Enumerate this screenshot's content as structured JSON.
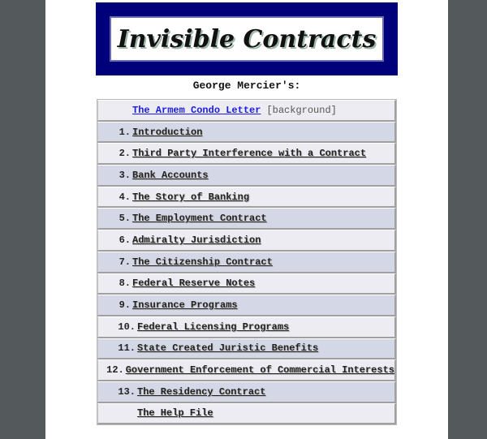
{
  "banner": {
    "title": "Invisible Contracts"
  },
  "subtitle": "George Mercier's:",
  "intro": {
    "label": "The Armem Condo Letter",
    "note": "[background]"
  },
  "items": [
    {
      "num": "1.",
      "label": "Introduction"
    },
    {
      "num": "2.",
      "label": "Third Party Interference with a Contract"
    },
    {
      "num": "3.",
      "label": "Bank Accounts"
    },
    {
      "num": "4.",
      "label": "The Story of Banking"
    },
    {
      "num": "5.",
      "label": "The Employment Contract"
    },
    {
      "num": "6.",
      "label": "Admiralty Jurisdiction"
    },
    {
      "num": "7.",
      "label": "The Citizenship Contract"
    },
    {
      "num": "8.",
      "label": "Federal Reserve Notes"
    },
    {
      "num": "9.",
      "label": "Insurance Programs"
    },
    {
      "num": "10.",
      "label": "Federal Licensing Programs"
    },
    {
      "num": "11.",
      "label": "State Created Juristic Benefits"
    },
    {
      "num": "12.",
      "label": "Government Enforcement of Commercial Interests"
    },
    {
      "num": "13.",
      "label": "The Residency Contract"
    }
  ],
  "help": {
    "label": "The Help File"
  },
  "colors": {
    "banner": "#00007a",
    "row_light": "#ececf2",
    "row_dark": "#d3d7e6",
    "link_blue": "#1a1ae6"
  }
}
